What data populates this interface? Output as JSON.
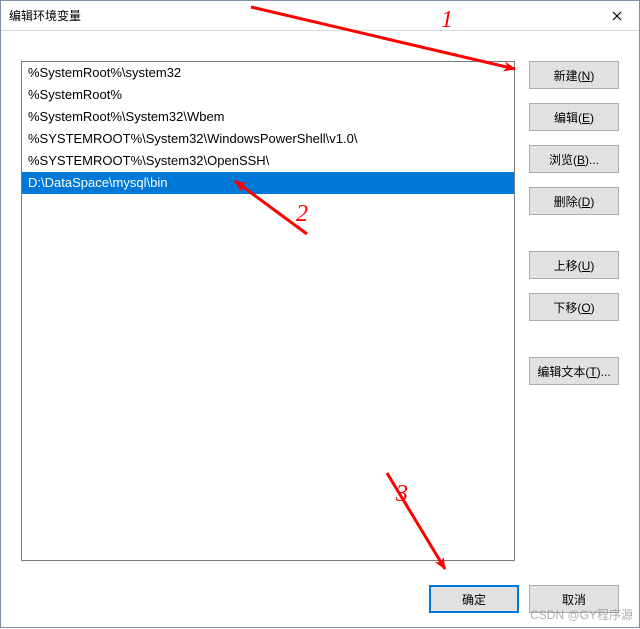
{
  "window": {
    "title": "编辑环境变量"
  },
  "path_list": {
    "items": [
      "%SystemRoot%\\system32",
      "%SystemRoot%",
      "%SystemRoot%\\System32\\Wbem",
      "%SYSTEMROOT%\\System32\\WindowsPowerShell\\v1.0\\",
      "%SYSTEMROOT%\\System32\\OpenSSH\\",
      "D:\\DataSpace\\mysql\\bin"
    ],
    "selected_index": 5
  },
  "buttons": {
    "new": {
      "label": "新建",
      "mnemonic": "N"
    },
    "edit": {
      "label": "编辑",
      "mnemonic": "E"
    },
    "browse": {
      "label": "浏览",
      "mnemonic": "B",
      "suffix": "..."
    },
    "delete": {
      "label": "删除",
      "mnemonic": "D"
    },
    "move_up": {
      "label": "上移",
      "mnemonic": "U"
    },
    "move_down": {
      "label": "下移",
      "mnemonic": "O"
    },
    "edit_text": {
      "label": "编辑文本",
      "mnemonic": "T",
      "suffix": "..."
    },
    "ok": {
      "label": "确定"
    },
    "cancel": {
      "label": "取消"
    }
  },
  "annotations": {
    "l1": "1",
    "l2": "2",
    "l3": "3"
  },
  "watermark": "CSDN @GY程序源"
}
